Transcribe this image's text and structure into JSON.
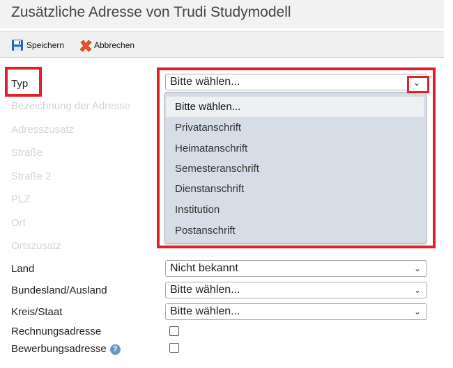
{
  "page": {
    "title": "Zusätzliche Adresse von Trudi Studymodell"
  },
  "toolbar": {
    "save_label": "Speichern",
    "cancel_label": "Abbrechen"
  },
  "form": {
    "typ_label": "Typ",
    "typ_select_value": "Bitte wählen...",
    "faded_labels": [
      "Bezeichnung der Adresse",
      "Adresszusatz",
      "Straße",
      "Straße 2",
      "PLZ",
      "Ort",
      "Ortszusatz"
    ],
    "land_label": "Land",
    "land_value": "Nicht bekannt",
    "bundesland_label": "Bundesland/Ausland",
    "bundesland_value": "Bitte wählen...",
    "kreis_label": "Kreis/Staat",
    "kreis_value": "Bitte wählen...",
    "rechnung_label": "Rechnungsadresse",
    "bewerbung_label": "Bewerbungsadresse",
    "rechnung_checked": false,
    "bewerbung_checked": false
  },
  "dropdown": {
    "options": [
      "Bitte wählen...",
      "Privatanschrift",
      "Heimatanschrift",
      "Semesteranschrift",
      "Dienstanschrift",
      "Institution",
      "Postanschrift"
    ],
    "selected_index": 0
  },
  "colors": {
    "highlight": "#e0202a",
    "dropdown_bg": "#d7dde6",
    "help_icon": "#6b95c6"
  },
  "icons": {
    "save": "floppy-disk-icon",
    "cancel": "red-x-icon",
    "help": "question-mark-icon",
    "chevron": "chevron-down-icon"
  }
}
